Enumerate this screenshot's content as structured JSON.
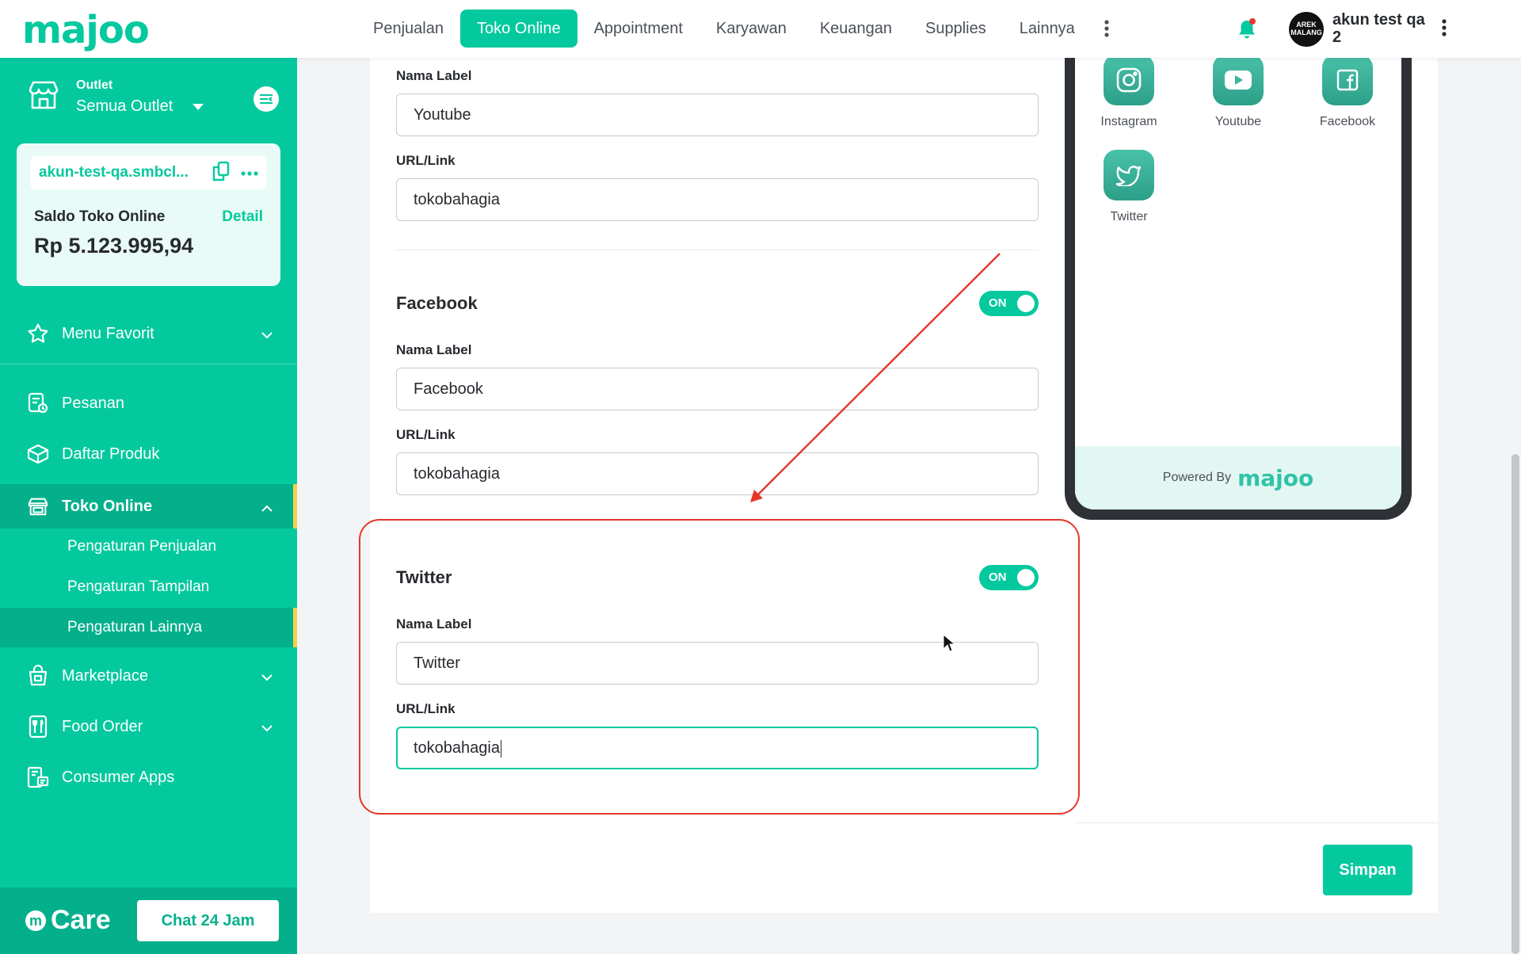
{
  "topbar": {
    "logo": "majoo",
    "nav": [
      "Penjualan",
      "Toko Online",
      "Appointment",
      "Karyawan",
      "Keuangan",
      "Supplies",
      "Lainnya"
    ],
    "active_nav": "Toko Online",
    "avatar_text": "AREK MALANG",
    "user_name": "akun test qa 2"
  },
  "sidebar": {
    "outlet_label": "Outlet",
    "outlet_value": "Semua Outlet",
    "store_link": "akun-test-qa.smbcl...",
    "saldo_label": "Saldo Toko Online",
    "saldo_detail": "Detail",
    "saldo_amount": "Rp 5.123.995,94",
    "items": [
      {
        "label": "Menu Favorit"
      },
      {
        "label": "Pesanan"
      },
      {
        "label": "Daftar Produk"
      },
      {
        "label": "Toko Online"
      },
      {
        "label": "Marketplace"
      },
      {
        "label": "Food Order"
      },
      {
        "label": "Consumer Apps"
      }
    ],
    "sub_items": [
      {
        "label": "Pengaturan Penjualan"
      },
      {
        "label": "Pengaturan Tampilan"
      },
      {
        "label": "Pengaturan Lainnya"
      }
    ],
    "care_label": "Care",
    "chat_button": "Chat 24 Jam"
  },
  "form": {
    "youtube": {
      "label_title": "Nama Label",
      "label_value": "Youtube",
      "url_title": "URL/Link",
      "url_value": "tokobahagia"
    },
    "facebook": {
      "title": "Facebook",
      "toggle": "ON",
      "label_title": "Nama Label",
      "label_value": "Facebook",
      "url_title": "URL/Link",
      "url_value": "tokobahagia"
    },
    "twitter": {
      "title": "Twitter",
      "toggle": "ON",
      "label_title": "Nama Label",
      "label_value": "Twitter",
      "url_title": "URL/Link",
      "url_value": "tokobahagia"
    },
    "save_button": "Simpan"
  },
  "preview": {
    "socials": [
      {
        "label": "Instagram",
        "icon": "instagram-icon"
      },
      {
        "label": "Youtube",
        "icon": "youtube-icon"
      },
      {
        "label": "Facebook",
        "icon": "facebook-icon"
      },
      {
        "label": "Twitter",
        "icon": "twitter-icon"
      }
    ],
    "powered_by": "Powered By",
    "powered_logo": "majoo"
  },
  "colors": {
    "brand": "#04c99e",
    "brand_dark": "#03b08b",
    "annotation": "#e4372a",
    "active_marker": "#f3d24a"
  }
}
